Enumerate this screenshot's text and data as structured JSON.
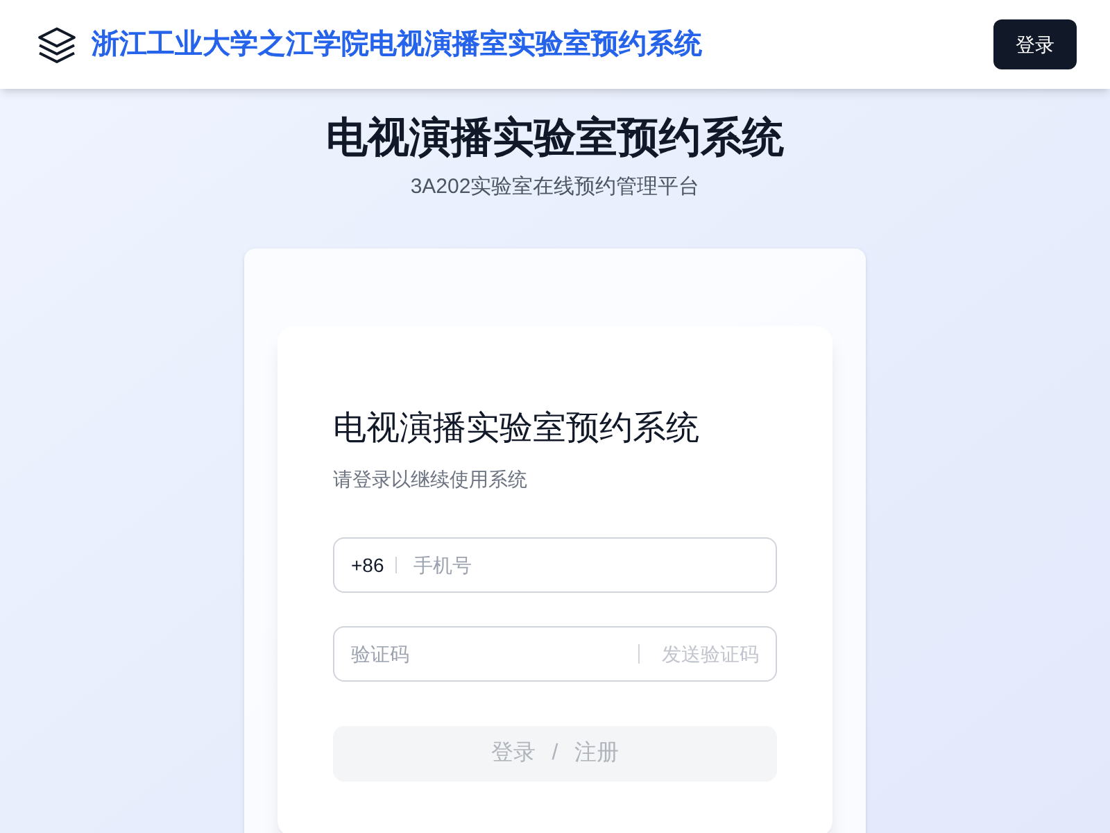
{
  "header": {
    "title": "浙江工业大学之江学院电视演播室实验室预约系统",
    "login_button": "登录"
  },
  "hero": {
    "title": "电视演播实验室预约系统",
    "subtitle": "3A202实验室在线预约管理平台"
  },
  "login_card": {
    "title": "电视演播实验室预约系统",
    "subtitle": "请登录以继续使用系统",
    "phone": {
      "prefix": "+86",
      "placeholder": "手机号"
    },
    "code": {
      "placeholder": "验证码",
      "send_button": "发送验证码",
      "send_disabled": true
    },
    "submit": {
      "label_login": "登录",
      "separator": "/",
      "label_register": "注册",
      "disabled": true
    }
  }
}
